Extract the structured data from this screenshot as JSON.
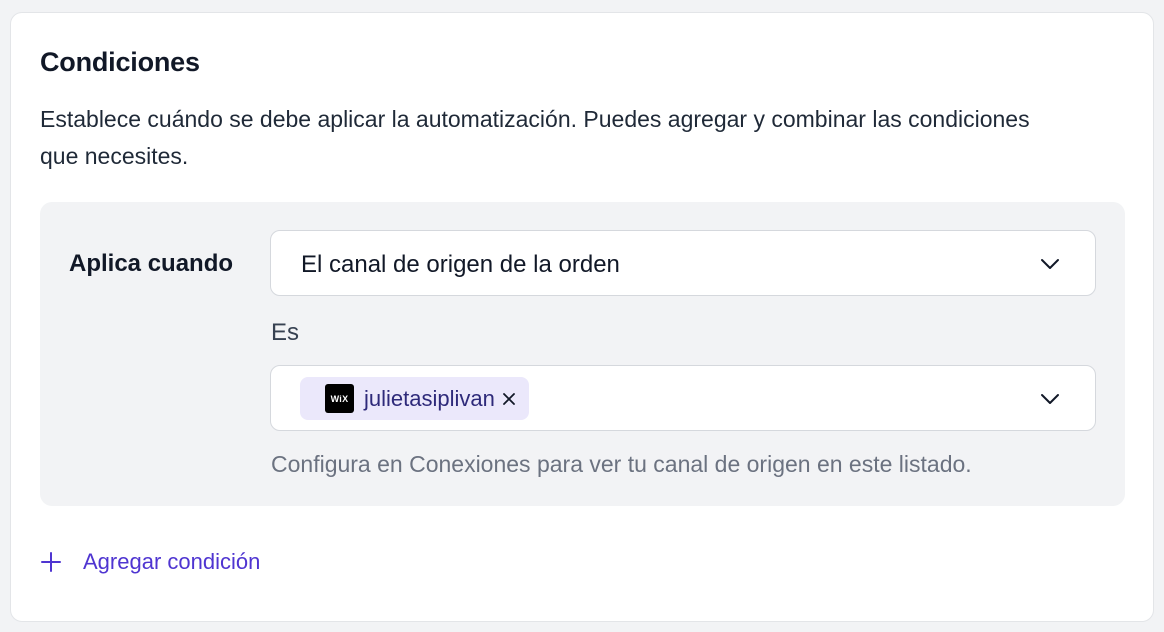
{
  "section": {
    "title": "Condiciones",
    "description": "Establece cuándo se debe aplicar la automatización. Puedes agregar y combinar las condiciones que necesites."
  },
  "condition": {
    "applies_label": "Aplica cuando",
    "field": {
      "selected": "El canal de origen de la orden",
      "icon": "chevron-down-icon"
    },
    "operator_label": "Es",
    "value": {
      "chips": [
        {
          "logo_text": "WiX",
          "label": "julietasiplivan",
          "icon": "close-icon"
        }
      ],
      "icon": "chevron-down-icon"
    },
    "hint": "Configura en Conexiones para ver tu canal de origen en este listado."
  },
  "actions": {
    "add_condition_label": "Agregar condición",
    "add_icon": "plus-icon"
  },
  "colors": {
    "accent": "#4f35d1",
    "chip_bg": "#ebe8fb",
    "chip_text": "#2e2a7a",
    "panel_bg": "#f2f3f5",
    "hint_text": "#6b7280"
  }
}
